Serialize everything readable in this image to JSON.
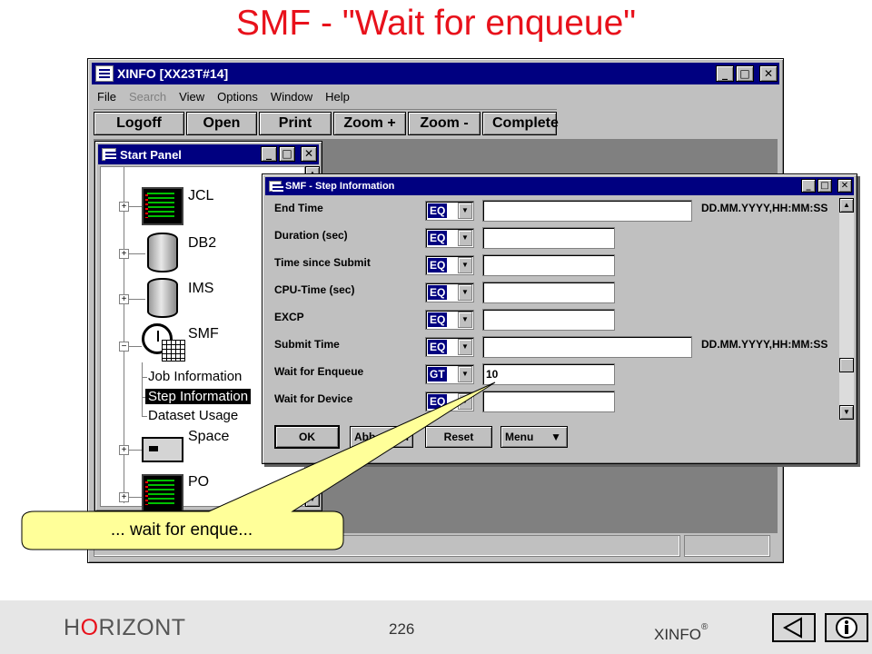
{
  "slide": {
    "title": "SMF - \"Wait for enqueue\""
  },
  "main_window": {
    "title": "XINFO [XX23T#14]",
    "controls": {
      "minimize": "_",
      "maximize": "□",
      "close": "✕"
    },
    "menu": [
      "File",
      "Search",
      "View",
      "Options",
      "Window",
      "Help"
    ],
    "toolbar": [
      "Logoff",
      "Open",
      "Print",
      "Zoom +",
      "Zoom -",
      "Complete"
    ]
  },
  "start_panel": {
    "title": "Start Panel",
    "items": [
      "JCL",
      "DB2",
      "IMS",
      "SMF",
      "Space",
      "PO"
    ],
    "smf_children": [
      "Job Information",
      "Step Information",
      "Dataset Usage"
    ],
    "selected_child": "Step Information"
  },
  "dialog": {
    "title": "SMF - Step Information",
    "fields": [
      {
        "label": "End Time",
        "op": "EQ",
        "value": "",
        "hint": "DD.MM.YYYY,HH:MM:SS"
      },
      {
        "label": "Duration (sec)",
        "op": "EQ",
        "value": "",
        "hint": ""
      },
      {
        "label": "Time since Submit",
        "op": "EQ",
        "value": "",
        "hint": ""
      },
      {
        "label": "CPU-Time (sec)",
        "op": "EQ",
        "value": "",
        "hint": ""
      },
      {
        "label": "EXCP",
        "op": "EQ",
        "value": "",
        "hint": ""
      },
      {
        "label": "Submit Time",
        "op": "EQ",
        "value": "",
        "hint": "DD.MM.YYYY,HH:MM:SS"
      },
      {
        "label": "Wait for Enqueue",
        "op": "GT",
        "value": "10",
        "hint": ""
      },
      {
        "label": "Wait for Device",
        "op": "EQ",
        "value": "",
        "hint": ""
      }
    ],
    "buttons": {
      "ok": "OK",
      "abbr": "Abb",
      "abbr_tail": "n",
      "reset": "Reset",
      "menu": "Menu"
    }
  },
  "callout": {
    "text": "... wait for enque..."
  },
  "footer": {
    "brand_pre": "H",
    "brand_o": "O",
    "brand_post": "RIZONT",
    "page": "226",
    "product": "XINFO",
    "trademark": "®"
  },
  "colors": {
    "title_red": "#e8111b",
    "window_blue": "#000080",
    "callout_yellow": "#ffff99"
  }
}
